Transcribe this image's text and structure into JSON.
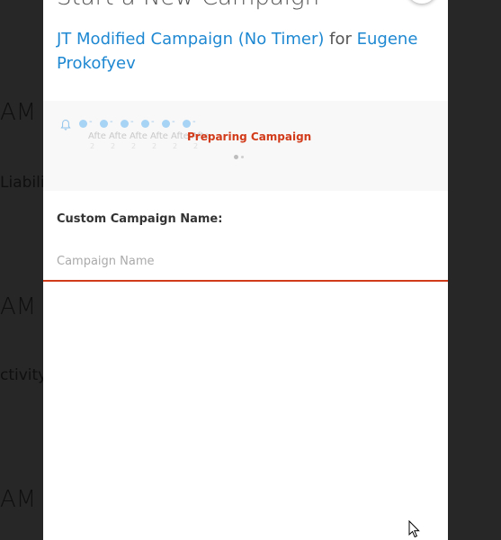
{
  "background": {
    "items": [
      "AM",
      "Liabili",
      "AM",
      "ctivity",
      "AM"
    ]
  },
  "modal": {
    "title": "Start a New Campaign",
    "campaign_name": "JT Modified Campaign (No Timer)",
    "for_text": "for",
    "contact_name": "Eugene Prokofyev",
    "close_icon": "close-icon"
  },
  "progress": {
    "icon": "bell-icon",
    "steps": [
      {
        "label": "Afte",
        "sub": "2"
      },
      {
        "label": "Afte",
        "sub": "2"
      },
      {
        "label": "Afte",
        "sub": "2"
      },
      {
        "label": "Afte",
        "sub": "2"
      },
      {
        "label": "Afte",
        "sub": "2"
      },
      {
        "label": "Afte",
        "sub": "2"
      }
    ],
    "status": "Preparing Campaign",
    "pages": 2,
    "active_page": 1
  },
  "form": {
    "label": "Custom Campaign Name:",
    "placeholder": "Campaign Name",
    "value": ""
  },
  "colors": {
    "accent": "#d23b1a",
    "link": "#1e88d2",
    "step": "#a7d3f5"
  }
}
